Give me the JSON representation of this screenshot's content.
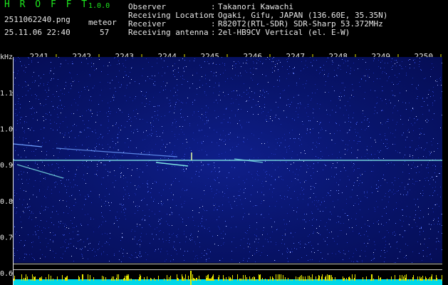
{
  "header": {
    "app_title": "H R O F F T",
    "app_version": "1.0.0",
    "file_name": "2511062240.png",
    "date_time": "25.11.06 22:40",
    "event_label": "meteor",
    "event_count": "57"
  },
  "info": [
    {
      "label": "Observer",
      "value": "Takanori Kawachi"
    },
    {
      "label": "Receiving Location",
      "value": "Ogaki, Gifu, JAPAN (136.60E, 35.35N)"
    },
    {
      "label": "Receiver",
      "value": "R820T2(RTL-SDR) SDR-Sharp 53.372MHz"
    },
    {
      "label": "Receiving antenna",
      "value": "2el-HB9CV Vertical (el. E-W)"
    }
  ],
  "axis": {
    "y_unit": "kHz",
    "y_ticks": [
      "1.1",
      "1.0",
      "0.9",
      "0.8",
      "0.7",
      "0.6"
    ],
    "x_ticks": [
      "2241",
      "2242",
      "2243",
      "2244",
      "2245",
      "2246",
      "2247",
      "2248",
      "2249",
      "2250"
    ]
  },
  "colors": {
    "background": "#000000",
    "spectrogram_bg": "#08146a",
    "title_green": "#1ee61e",
    "tick_yellow": "#e6e600",
    "signal_cyan": "#7fe6e6",
    "meteor_yellow": "#e6e600",
    "baseline_cyan": "#00d8e8"
  }
}
